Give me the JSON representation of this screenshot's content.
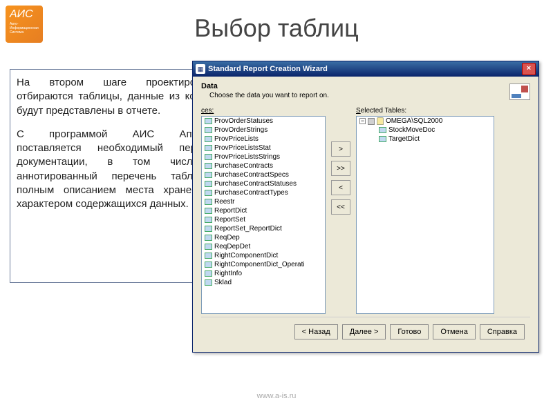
{
  "logo": {
    "title": "АИС",
    "sub": "Авто-Информационная Система"
  },
  "page_title": "Выбор таблиц",
  "paragraphs": [
    "На втором шаге проектирования отбираются таблицы, данные из которых будут представлены в отчете.",
    "С программой АИС Аптекарь поставляется необходимый перечень документации, в том числе и аннотированный перечень таблиц с полным описанием места хранения и характером содержащихся данных."
  ],
  "footer": "www.a-is.ru",
  "dialog": {
    "title": "Standard Report Creation Wizard",
    "heading": "Data",
    "sub": "Choose the data you want to report on.",
    "sources_label": "ces:",
    "selected_label": "Selected Tables:",
    "source_items": [
      "ProvOrderStatuses",
      "ProvOrderStrings",
      "ProvPriceLists",
      "ProvPriceListsStat",
      "ProvPriceListsStrings",
      "PurchaseContracts",
      "PurchaseContractSpecs",
      "PurchaseContractStatuses",
      "PurchaseContractTypes",
      "Reestr",
      "ReportDict",
      "ReportSet",
      "ReportSet_ReportDict",
      "ReqDep",
      "ReqDepDet",
      "RightComponentDict",
      "RightComponentDict_Operati",
      "RightInfo",
      "Sklad"
    ],
    "server": "OMEGA\\SQL2000",
    "selected_items": [
      "StockMoveDoc",
      "TargetDict"
    ],
    "btn_add": ">",
    "btn_add_all": ">>",
    "btn_rem": "<",
    "btn_rem_all": "<<",
    "buttons": {
      "back": "< Назад",
      "next": "Далее >",
      "finish": "Готово",
      "cancel": "Отмена",
      "help": "Справка"
    }
  }
}
